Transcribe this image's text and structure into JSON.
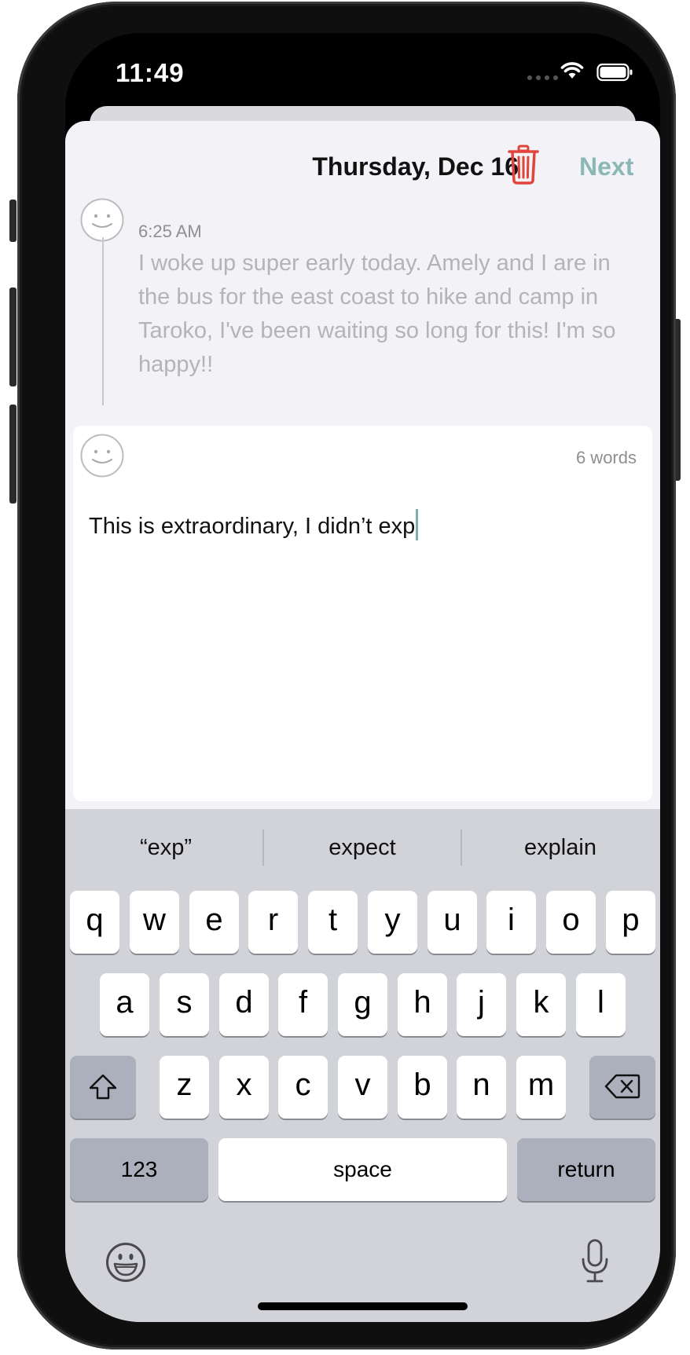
{
  "status_bar": {
    "time": "11:49"
  },
  "header": {
    "date": "Thursday, Dec 16",
    "next_label": "Next"
  },
  "previous_entry": {
    "time": "6:25 AM",
    "text": "I woke up super early today. Amely and I are in the bus for the east coast to hike and camp in Taroko, I've been waiting so long for this! I'm so happy!!"
  },
  "current_entry": {
    "word_count": "6 words",
    "text": "This is extraordinary, I didn’t exp"
  },
  "keyboard": {
    "suggestions": [
      "“exp”",
      "expect",
      "explain"
    ],
    "row1": [
      "q",
      "w",
      "e",
      "r",
      "t",
      "y",
      "u",
      "i",
      "o",
      "p"
    ],
    "row2": [
      "a",
      "s",
      "d",
      "f",
      "g",
      "h",
      "j",
      "k",
      "l"
    ],
    "row3": [
      "z",
      "x",
      "c",
      "v",
      "b",
      "n",
      "m"
    ],
    "numbers_label": "123",
    "space_label": "space",
    "return_label": "return"
  },
  "colors": {
    "accent": "#8bb8b5",
    "delete": "#e0443a",
    "caret": "#7fb0ad"
  },
  "icons": [
    "signal-dots-icon",
    "wifi-icon",
    "battery-icon",
    "trash-icon",
    "smiley-avatar-icon",
    "shift-icon",
    "backspace-icon",
    "emoji-icon",
    "microphone-icon"
  ]
}
